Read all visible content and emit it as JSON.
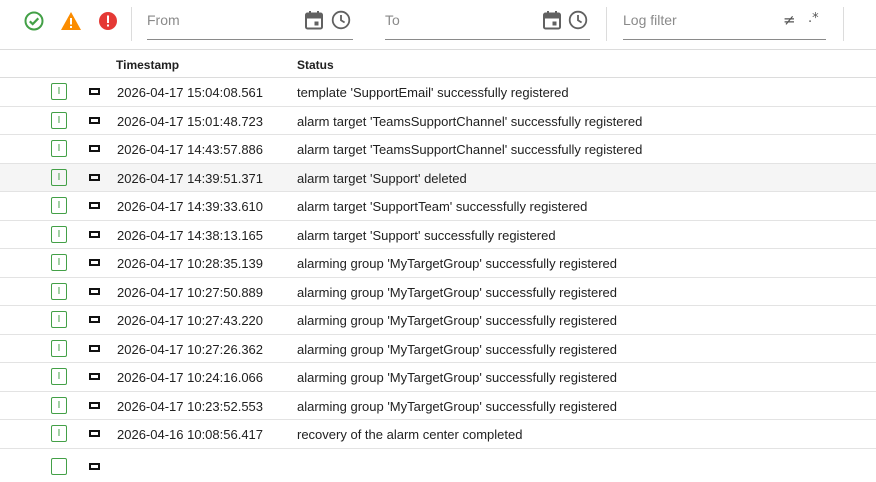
{
  "filters": {
    "from_placeholder": "From",
    "to_placeholder": "To",
    "log_filter_placeholder": "Log filter",
    "not_equal_symbol": "≠",
    "regex_symbol": ".*"
  },
  "level_icons": [
    "check-circle-icon",
    "warning-triangle-icon",
    "error-circle-icon"
  ],
  "colors": {
    "ok": "#43a047",
    "warning": "#fb8c00",
    "error": "#e53935",
    "icon_gray": "#616161"
  },
  "table": {
    "headers": {
      "timestamp": "Timestamp",
      "status": "Status"
    },
    "rows": [
      {
        "level": "I",
        "timestamp": "2026-04-17 15:04:08.561",
        "status": "template 'SupportEmail' successfully registered"
      },
      {
        "level": "I",
        "timestamp": "2026-04-17 15:01:48.723",
        "status": "alarm target 'TeamsSupportChannel' successfully registered"
      },
      {
        "level": "I",
        "timestamp": "2026-04-17 14:43:57.886",
        "status": "alarm target 'TeamsSupportChannel' successfully registered"
      },
      {
        "level": "I",
        "timestamp": "2026-04-17 14:39:51.371",
        "status": "alarm target 'Support' deleted"
      },
      {
        "level": "I",
        "timestamp": "2026-04-17 14:39:33.610",
        "status": "alarm target 'SupportTeam' successfully registered"
      },
      {
        "level": "I",
        "timestamp": "2026-04-17 14:38:13.165",
        "status": "alarm target 'Support' successfully registered"
      },
      {
        "level": "I",
        "timestamp": "2026-04-17 10:28:35.139",
        "status": "alarming group 'MyTargetGroup' successfully registered"
      },
      {
        "level": "I",
        "timestamp": "2026-04-17 10:27:50.889",
        "status": "alarming group 'MyTargetGroup' successfully registered"
      },
      {
        "level": "I",
        "timestamp": "2026-04-17 10:27:43.220",
        "status": "alarming group 'MyTargetGroup' successfully registered"
      },
      {
        "level": "I",
        "timestamp": "2026-04-17 10:27:26.362",
        "status": "alarming group 'MyTargetGroup' successfully registered"
      },
      {
        "level": "I",
        "timestamp": "2026-04-17 10:24:16.066",
        "status": "alarming group 'MyTargetGroup' successfully registered"
      },
      {
        "level": "I",
        "timestamp": "2026-04-17 10:23:52.553",
        "status": "alarming group 'MyTargetGroup' successfully registered"
      },
      {
        "level": "I",
        "timestamp": "2026-04-16 10:08:56.417",
        "status": "recovery of the alarm center completed"
      }
    ]
  }
}
